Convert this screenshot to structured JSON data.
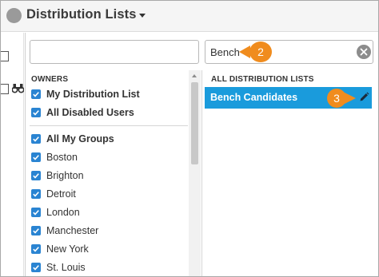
{
  "header": {
    "title": "Distribution Lists"
  },
  "owners_search": {
    "value": ""
  },
  "lists_search": {
    "value": "Bench"
  },
  "owners": {
    "heading": "OWNERS",
    "items": [
      {
        "label": "My Distribution List",
        "bold": true,
        "checked": true
      },
      {
        "label": "All Disabled Users",
        "bold": true,
        "checked": true
      },
      {
        "label": "All My Groups",
        "bold": true,
        "checked": true
      },
      {
        "label": "Boston",
        "bold": false,
        "checked": true
      },
      {
        "label": "Brighton",
        "bold": false,
        "checked": true
      },
      {
        "label": "Detroit",
        "bold": false,
        "checked": true
      },
      {
        "label": "London",
        "bold": false,
        "checked": true
      },
      {
        "label": "Manchester",
        "bold": false,
        "checked": true
      },
      {
        "label": "New York",
        "bold": false,
        "checked": true
      },
      {
        "label": "St. Louis",
        "bold": false,
        "checked": true
      }
    ]
  },
  "lists": {
    "heading": "ALL DISTRIBUTION LISTS",
    "items": [
      {
        "label": "Bench Candidates",
        "selected": true
      }
    ]
  },
  "callouts": {
    "step_2": "2",
    "step_3": "3"
  },
  "colors": {
    "accent": "#1a9bdc",
    "checkbox": "#2a84d2",
    "callout": "#f08c1e"
  },
  "icons": {
    "header_status": "circle-icon",
    "dropdown": "caret-down-icon",
    "clear": "clear-icon",
    "edit": "pencil-icon",
    "background_action": "binoculars-icon"
  }
}
